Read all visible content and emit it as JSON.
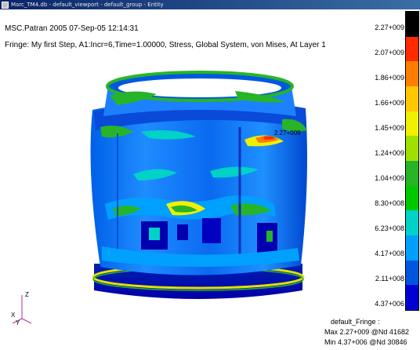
{
  "window": {
    "title": "Marc_TM4.db - default_viewport - default_group - Entity"
  },
  "header": {
    "line1": "MSC.Patran 2005 07-Sep-05 12:14:31",
    "line2": "Fringe: My first Step, A1:Incr=6,Time=1.00000, Stress, Global System, von Mises, At Layer 1"
  },
  "model": {
    "max_marker": "2.27+009"
  },
  "legend": {
    "labels": [
      "2.27+009",
      "2.07+009",
      "1.86+009",
      "1.66+009",
      "1.45+009",
      "1.24+009",
      "1.04+009",
      "8.30+008",
      "6.23+008",
      "4.17+008",
      "2.11+008",
      "4.37+006"
    ],
    "colors": [
      "#000000",
      "#ff2a00",
      "#ff7d00",
      "#ffc800",
      "#f0f000",
      "#a0e000",
      "#28b428",
      "#00c800",
      "#00d2c8",
      "#00a0ff",
      "#0055e0",
      "#0000d2"
    ]
  },
  "axes": {
    "x": "X",
    "y": "Y",
    "z": "Z"
  },
  "footer": {
    "title": "default_Fringe :",
    "max": "Max 2.27+009 @Nd 41682",
    "min": "Min 4.37+006 @Nd 30846"
  }
}
